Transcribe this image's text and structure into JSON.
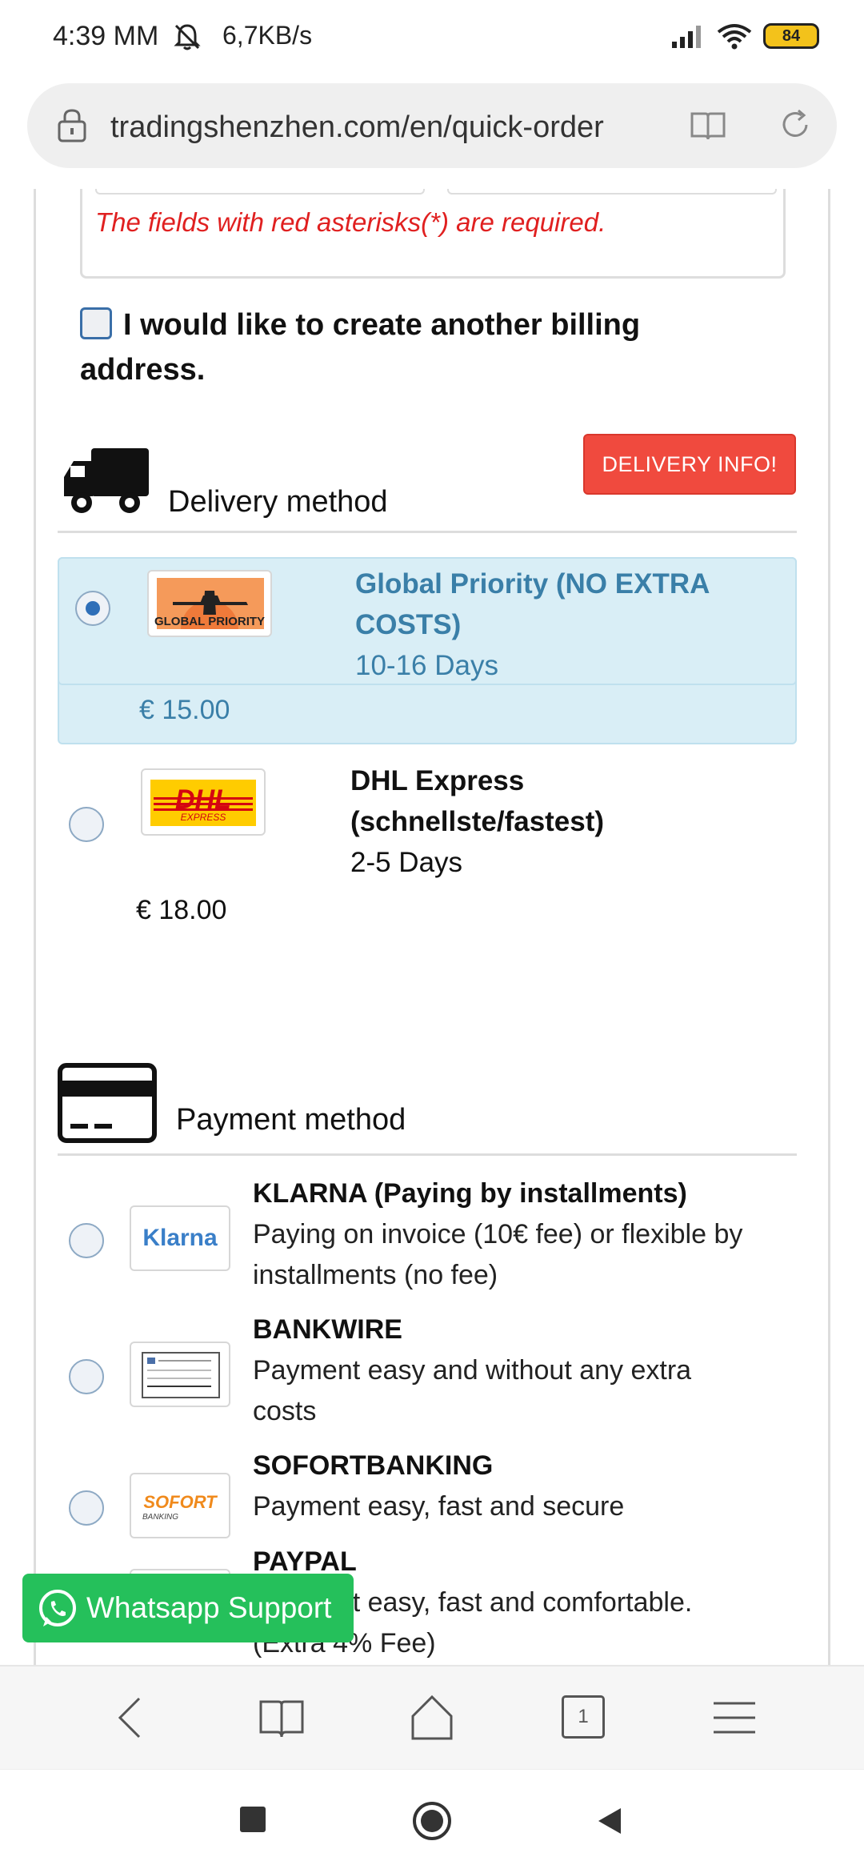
{
  "status_bar": {
    "time": "4:39 MM",
    "net_speed": "6,7KB/s",
    "battery": "84"
  },
  "browser": {
    "url": "tradingshenzhen.com/en/quick-order"
  },
  "form": {
    "required_note": "The fields with red asterisks(*) are required.",
    "billing_checkbox_label": "I would like to create another billing address."
  },
  "delivery": {
    "heading": "Delivery method",
    "info_button": "DELIVERY INFO!",
    "options": [
      {
        "name": "Global Priority (NO EXTRA COSTS)",
        "name_line1": "Global Priority (NO EXTRA",
        "name_line2": "COSTS)",
        "duration": "10-16 Days",
        "price": "€ 15.00",
        "logo_text": "GLOBAL PRIORITY",
        "selected": true
      },
      {
        "name": "DHL Express (schnellste/fastest)",
        "name_line1": "DHL Express",
        "name_line2": "(schnellste/fastest)",
        "duration": "2-5 Days",
        "price": "€ 18.00",
        "logo_text": "DHL",
        "logo_sub": "EXPRESS",
        "selected": false
      }
    ]
  },
  "payment": {
    "heading": "Payment method",
    "options": [
      {
        "title": "KLARNA (Paying by installments)",
        "desc_line1": "Paying on invoice (10€ fee) or flexible by",
        "desc_line2": "installments (no fee)",
        "logo_text": "Klarna"
      },
      {
        "title": "BANKWIRE",
        "desc_line1": "Payment easy and without any extra",
        "desc_line2": "costs"
      },
      {
        "title": "SOFORTBANKING",
        "desc_line1": "Payment easy, fast and secure",
        "logo_text": "SOFORT",
        "logo_sub": "BANKING"
      },
      {
        "title": "PAYPAL",
        "desc_line1": "Payment easy, fast and comfortable.",
        "desc_line2": "(Extra 4% Fee)"
      }
    ]
  },
  "support": {
    "whatsapp_label": "Whatsapp Support"
  },
  "bottom_bar": {
    "tabs_count": "1"
  },
  "colors": {
    "accent_blue": "#3a7fa8",
    "selected_bg": "#d9eef6",
    "red_button": "#f04a3e",
    "required_red": "#e02020",
    "whatsapp_green": "#25c05b"
  }
}
